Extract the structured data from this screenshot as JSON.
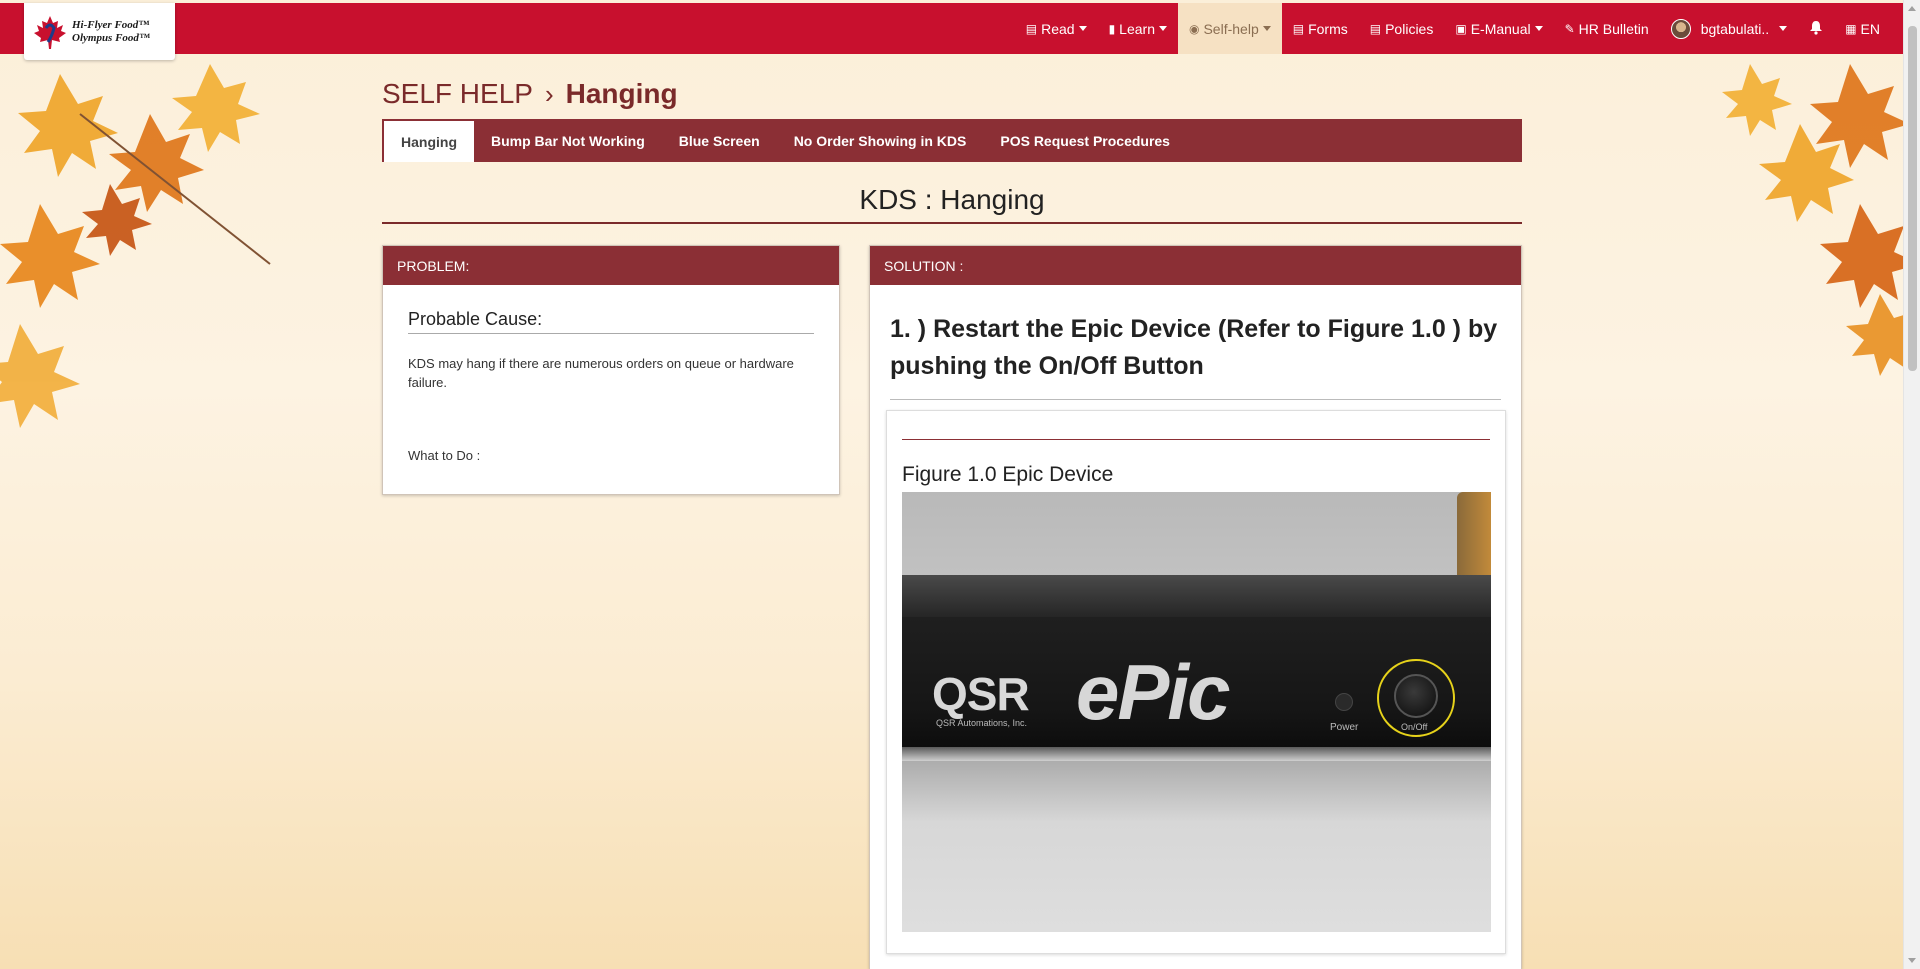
{
  "colors": {
    "navbar": "#c8102e",
    "accent_dark": "#8b2f35",
    "active_nav_bg": "#f6e1c3",
    "highlight_ring": "#e6d21a"
  },
  "brand": {
    "line1": "Hi-Flyer Food™",
    "line2": "Olympus Food™",
    "icon": "maple-leaf-icon"
  },
  "nav": {
    "read": "Read",
    "learn": "Learn",
    "selfhelp": "Self-help",
    "forms": "Forms",
    "policies": "Policies",
    "emanual": "E-Manual",
    "hrbulletin": "HR Bulletin",
    "user": "bgtabulati..",
    "language": "EN",
    "active": "Self-help"
  },
  "breadcrumb": {
    "section": "SELF HELP",
    "current": "Hanging"
  },
  "tabs": [
    {
      "label": "Hanging",
      "active": true
    },
    {
      "label": "Bump Bar Not Working",
      "active": false
    },
    {
      "label": "Blue Screen",
      "active": false
    },
    {
      "label": "No Order Showing in KDS",
      "active": false
    },
    {
      "label": "POS Request Procedures",
      "active": false
    }
  ],
  "page_title": "KDS : Hanging",
  "problem": {
    "header": "PROBLEM:",
    "cause_title": "Probable Cause:",
    "cause_text": "KDS may hang if there are numerous orders on queue or hardware failure.",
    "todo": "What to Do :"
  },
  "solution": {
    "header": "SOLUTION :",
    "step1": "1. ) Restart the Epic Device (Refer to Figure 1.0 ) by pushing the On/Off Button",
    "figure_caption": "Figure 1.0 Epic Device",
    "photo": {
      "brand": "QSR",
      "brand_sub": "QSR Automations, Inc.",
      "product": "ePic",
      "power_label": "Power",
      "button_label": "On/Off"
    }
  }
}
